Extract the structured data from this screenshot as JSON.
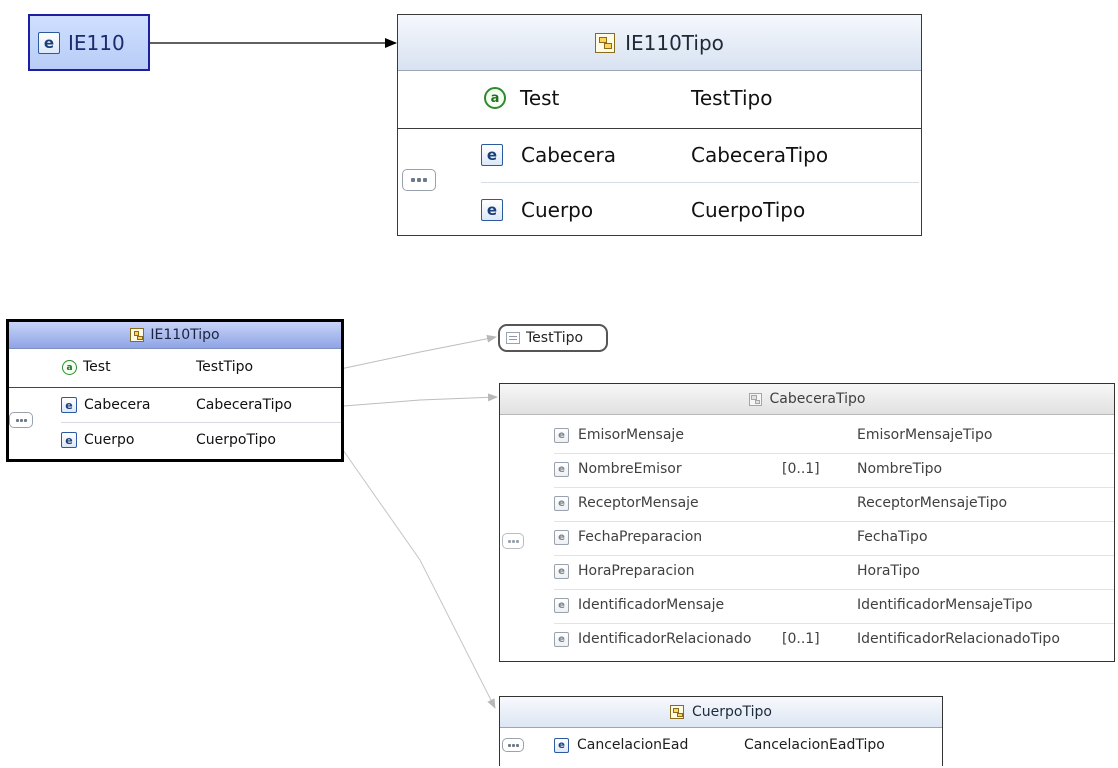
{
  "top": {
    "element": {
      "label": "IE110"
    },
    "type_box": {
      "title": "IE110Tipo",
      "attribute": {
        "name": "Test",
        "type": "TestTipo"
      },
      "children": [
        {
          "name": "Cabecera",
          "type": "CabeceraTipo"
        },
        {
          "name": "Cuerpo",
          "type": "CuerpoTipo"
        }
      ]
    }
  },
  "detail": {
    "type_box": {
      "title": "IE110Tipo",
      "attribute": {
        "name": "Test",
        "type": "TestTipo"
      },
      "children": [
        {
          "name": "Cabecera",
          "type": "CabeceraTipo"
        },
        {
          "name": "Cuerpo",
          "type": "CuerpoTipo"
        }
      ]
    },
    "simple_type": {
      "label": "TestTipo"
    },
    "cabecera": {
      "title": "CabeceraTipo",
      "children": [
        {
          "name": "EmisorMensaje",
          "occurs": "",
          "type": "EmisorMensajeTipo"
        },
        {
          "name": "NombreEmisor",
          "occurs": "[0..1]",
          "type": "NombreTipo"
        },
        {
          "name": "ReceptorMensaje",
          "occurs": "",
          "type": "ReceptorMensajeTipo"
        },
        {
          "name": "FechaPreparacion",
          "occurs": "",
          "type": "FechaTipo"
        },
        {
          "name": "HoraPreparacion",
          "occurs": "",
          "type": "HoraTipo"
        },
        {
          "name": "IdentificadorMensaje",
          "occurs": "",
          "type": "IdentificadorMensajeTipo"
        },
        {
          "name": "IdentificadorRelacionado",
          "occurs": "[0..1]",
          "type": "IdentificadorRelacionadoTipo"
        }
      ]
    },
    "cuerpo": {
      "title": "CuerpoTipo",
      "children": [
        {
          "name": "CancelacionEad",
          "type": "CancelacionEadTipo"
        }
      ]
    }
  },
  "icons": {
    "element": "element-icon",
    "attribute": "attribute-icon",
    "complex_type": "complex-type-icon",
    "simple_type": "simple-type-icon",
    "sequence": "sequence-icon"
  },
  "colors": {
    "selected_border": "#1b1fa0",
    "selected_fill": "#c4d6fb",
    "header_blue": "#9fb2ea",
    "connector_gray": "#b0b0b0"
  }
}
